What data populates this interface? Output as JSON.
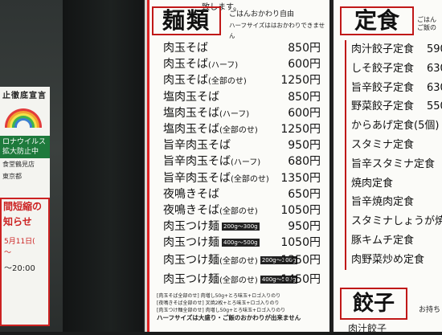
{
  "left_signs": {
    "declaration": "止徹底宣言",
    "corona_line1": "ロナウイルス",
    "corona_line2": "拡大防止中",
    "shop": "食堂鶴見店",
    "gov": "東京都",
    "notice_title1": "間短縮の",
    "notice_title2": "知らせ",
    "notice_date": "5月11日(",
    "notice_tilde": "〜",
    "notice_time": "〜20:00"
  },
  "ramen_board": {
    "intro": "致します。",
    "heading": "麺類",
    "note_line1": "ごはんおかわり自由",
    "note_line2": "ハーフサイズははおかわりできません",
    "items": [
      {
        "name": "肉玉そば",
        "sub": "",
        "tag": "",
        "price": "850円"
      },
      {
        "name": "肉玉そば",
        "sub": "(ハーフ)",
        "tag": "",
        "price": "600円"
      },
      {
        "name": "肉玉そば",
        "sub": "(全部のせ)",
        "tag": "",
        "price": "1250円"
      },
      {
        "name": "塩肉玉そば",
        "sub": "",
        "tag": "",
        "price": "850円"
      },
      {
        "name": "塩肉玉そば",
        "sub": "(ハーフ)",
        "tag": "",
        "price": "600円"
      },
      {
        "name": "塩肉玉そば",
        "sub": "(全部のせ)",
        "tag": "",
        "price": "1250円"
      },
      {
        "name": "旨辛肉玉そば",
        "sub": "",
        "tag": "",
        "price": "950円"
      },
      {
        "name": "旨辛肉玉そば",
        "sub": "(ハーフ)",
        "tag": "",
        "price": "680円"
      },
      {
        "name": "旨辛肉玉そば",
        "sub": "(全部のせ)",
        "tag": "",
        "price": "1350円"
      },
      {
        "name": "夜鳴きそば",
        "sub": "",
        "tag": "",
        "price": "650円"
      },
      {
        "name": "夜鳴きそば",
        "sub": "(全部のせ)",
        "tag": "",
        "price": "1050円"
      },
      {
        "name": "肉玉つけ麺",
        "sub": "",
        "tag": "200g〜300g",
        "price": "950円"
      },
      {
        "name": "肉玉つけ麺",
        "sub": "",
        "tag": "400g〜500g",
        "price": "1050円"
      },
      {
        "name": "肉玉つけ麺",
        "sub": "(全部のせ)",
        "tag": "200g〜300g",
        "price": "1350円"
      },
      {
        "name": "肉玉つけ麺",
        "sub": "(全部のせ)",
        "tag": "400g〜500g",
        "price": "1450円"
      }
    ],
    "foot_line1": "[肉玉そば全部のせ] 肉増し50g+とろ味玉+ロゴ入りのり",
    "foot_line2": "[夜鳴きそば全部のせ] 叉焼2枚+とろ味玉+ロゴ入りのり",
    "foot_line3": "[肉玉つけ麺全部のせ] 肉増し50g+とろ味玉+ロゴ入りのり",
    "foot_line4": "ハーフサイズは大盛り・ご飯のおかわりが出来ません"
  },
  "teishoku_board": {
    "heading": "定食",
    "note_line1": "ごはん",
    "note_line2": "ご飯の",
    "items": [
      {
        "name": "肉汁餃子定食",
        "price": "590"
      },
      {
        "name": "しそ餃子定食",
        "price": "630"
      },
      {
        "name": "旨辛餃子定食",
        "price": "630"
      },
      {
        "name": "野菜餃子定食",
        "price": "550"
      },
      {
        "name": "からあげ定食(5個)",
        "price": ""
      },
      {
        "name": "スタミナ定食",
        "price": ""
      },
      {
        "name": "旨辛スタミナ定食",
        "price": ""
      },
      {
        "name": "焼肉定食",
        "price": ""
      },
      {
        "name": "旨辛焼肉定食",
        "price": ""
      },
      {
        "name": "スタミナしょうが焼",
        "price": ""
      },
      {
        "name": "豚キムチ定食",
        "price": ""
      },
      {
        "name": "肉野菜炒め定食",
        "price": ""
      }
    ],
    "gyoza_heading": "餃子",
    "gyoza_note": "お持ち",
    "gyoza_first": "肉汁餃子"
  },
  "colors": {
    "accent_red": "#c01818",
    "board": "#fbfbf8",
    "frame": "#1d2120"
  }
}
